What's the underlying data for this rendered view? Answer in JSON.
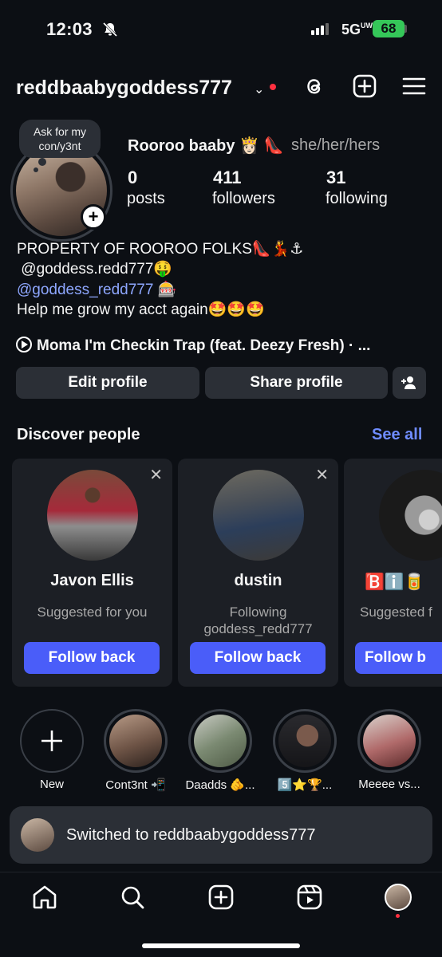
{
  "status_bar": {
    "time": "12:03",
    "network": "5G",
    "network_sub": "UW",
    "battery": "68"
  },
  "header": {
    "username": "reddbaabygoddess777",
    "chevron": "⌄"
  },
  "profile": {
    "note": "Ask for my con/y3nt",
    "display_name": "Rooroo baaby 👸🏻 👠",
    "pronouns": "she/her/hers",
    "stats": [
      {
        "value": "0",
        "label": "posts"
      },
      {
        "value": "411",
        "label": "followers"
      },
      {
        "value": "31",
        "label": "following"
      }
    ],
    "bio_lines": [
      "PROPERTY OF ROOROO FOLKS👠💃⚓",
      " @goddess.redd777🤑",
      "@goddess_redd777 🎰",
      "Help me grow my acct again🤩🤩🤩"
    ],
    "music": "Moma I'm Checkin Trap (feat. Deezy Fresh) · ..."
  },
  "buttons": {
    "edit": "Edit profile",
    "share": "Share profile"
  },
  "discover": {
    "title": "Discover people",
    "see_all": "See all",
    "cards": [
      {
        "name": "Javon Ellis",
        "sub": "Suggested for you",
        "button": "Follow back"
      },
      {
        "name": "dustin",
        "sub": "Following goddess_redd777",
        "button": "Follow back"
      },
      {
        "name": "🅱️ℹ️🥫",
        "sub": "Suggested f",
        "button": "Follow b"
      }
    ]
  },
  "highlights": [
    {
      "label": "New"
    },
    {
      "label": "Cont3nt 📲"
    },
    {
      "label": "Daadds 🫵..."
    },
    {
      "label": "5️⃣⭐🏆..."
    },
    {
      "label": "Meeee vs..."
    }
  ],
  "toast": {
    "text": "Switched to reddbaabygoddess777"
  },
  "colors": {
    "accent": "#4a5df9",
    "link": "#8ea7ff",
    "background": "#0c0f14",
    "surface": "#2b2f36",
    "notification": "#ff3040"
  }
}
